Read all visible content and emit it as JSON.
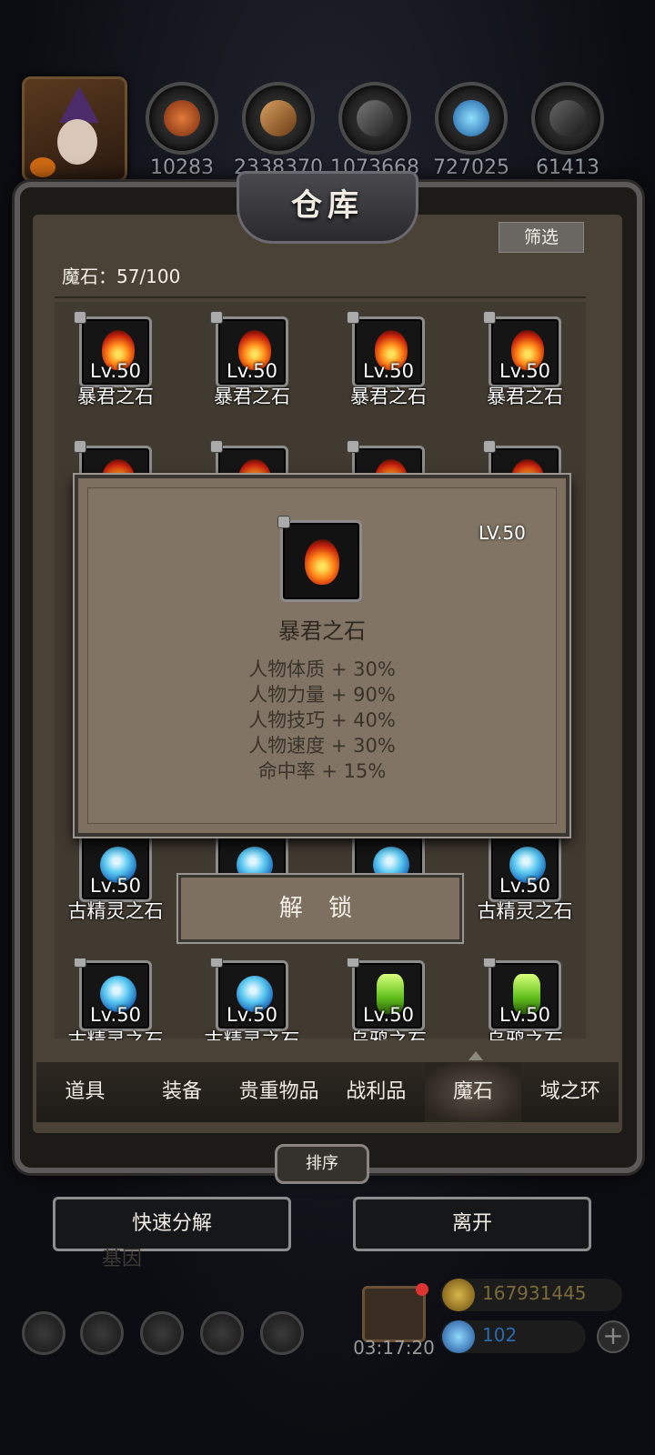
{
  "resources": [
    {
      "icon": "copper-ore-icon",
      "value": "10283"
    },
    {
      "icon": "wood-plank-icon",
      "value": "2338370"
    },
    {
      "icon": "iron-ingot-icon",
      "value": "1073668"
    },
    {
      "icon": "blue-crystal-icon",
      "value": "727025"
    },
    {
      "icon": "steel-ingot-icon",
      "value": "61413"
    }
  ],
  "warehouse": {
    "title": "仓库",
    "filter_label": "筛选",
    "capacity_label": "魔石：57/100"
  },
  "items": [
    {
      "name": "暴君之石",
      "level": "Lv.50",
      "type": "fire"
    },
    {
      "name": "暴君之石",
      "level": "Lv.50",
      "type": "fire"
    },
    {
      "name": "暴君之石",
      "level": "Lv.50",
      "type": "fire"
    },
    {
      "name": "暴君之石",
      "level": "Lv.50",
      "type": "fire"
    },
    {
      "name": "古精灵之石",
      "level": "Lv.50",
      "type": "ice"
    },
    {
      "name": "古精灵之石",
      "level": "Lv.50",
      "type": "ice"
    },
    {
      "name": "古精灵之石",
      "level": "Lv.50",
      "type": "ice"
    },
    {
      "name": "古精灵之石",
      "level": "Lv.50",
      "type": "ice"
    },
    {
      "name": "乌鸦之石",
      "level": "Lv.50",
      "type": "green"
    },
    {
      "name": "乌鸦之石",
      "level": "Lv.50",
      "type": "green"
    }
  ],
  "tabs": [
    {
      "label": "道具",
      "active": false
    },
    {
      "label": "装备",
      "active": false
    },
    {
      "label": "贵重物品",
      "active": false
    },
    {
      "label": "战利品",
      "active": false
    },
    {
      "label": "魔石",
      "active": true
    },
    {
      "label": "域之环",
      "active": false
    }
  ],
  "sort_label": "排序",
  "quick_decompose_label": "快速分解",
  "leave_label": "离开",
  "modal": {
    "level": "LV.50",
    "name": "暴君之石",
    "stats": [
      "人物体质 + 30%",
      "人物力量 + 90%",
      "人物技巧 + 40%",
      "人物速度 + 30%",
      "命中率 + 15%"
    ],
    "unlock_label": "解 锁"
  },
  "bottom_hud": {
    "timer": "03:17:20",
    "gold": "167931445",
    "gems": "102",
    "faded_text": "基因"
  },
  "colors": {
    "panel": "#4a4236",
    "modal": "#7d7060",
    "gold_text": "#7a6a3a",
    "gem_text": "#2a6ab0"
  }
}
